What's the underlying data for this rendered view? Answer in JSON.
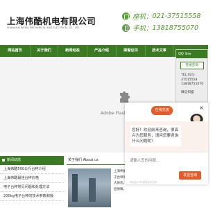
{
  "header": {
    "company_name": "上海伟酷机电有限公司",
    "company_en": "SHANGHAI WEIKU MECHANICAL AND ELECTRICAL CO., LTD.",
    "phone_label": "座机：",
    "phone_value": "021-37515558",
    "mobile_label": "手机：",
    "mobile_value": "13818755070"
  },
  "nav": {
    "items": [
      "网站首页",
      "关于我们",
      "新闻动态",
      "产品介绍",
      "荣誉证书",
      "技术文章"
    ]
  },
  "banner": {
    "flash_text": "Adobe Flash Player 5"
  },
  "news": {
    "title": "新闻动态",
    "items": [
      "上海伟酷500公斤台秤介绍",
      "上海伟酷最佳台秤价格",
      "电子台秤常见问题和处理方法",
      "200kg电子台秤的技术参数和操"
    ]
  },
  "about": {
    "title": "关于我们 About us",
    "text": "上海伟酷机电有限公司专业生产电子台秤等衡器产品，销售的产品量大质优，提供全面的技术服务和售后保障。"
  },
  "qq": {
    "title": "QQ line",
    "online_button": "在线咨询",
    "phone_lines": [
      "TEL:021-",
      "37515558",
      "13818755070"
    ],
    "code_label": "微信扫描"
  },
  "chat": {
    "status": "在线交流",
    "close_symbol": "×",
    "message": "您好！欢迎前来咨询，很高兴为您服务，请问您要咨询什么问题呢？",
    "input_placeholder": "请输入您的问题...",
    "send_label": "发送咨询",
    "credit": "网站由53KF提供技术支持"
  }
}
